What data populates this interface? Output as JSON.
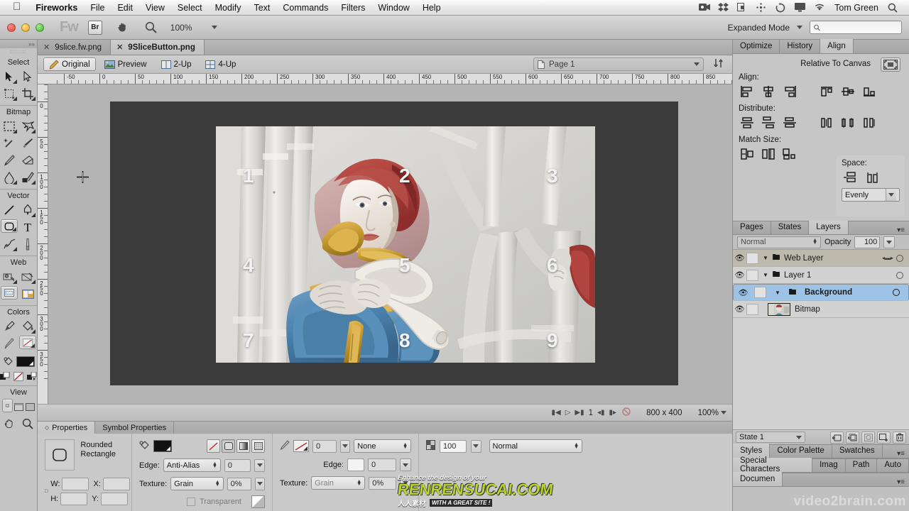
{
  "menubar": {
    "apple_icon": "apple-icon",
    "items": [
      {
        "label": "Fireworks",
        "bold": true
      },
      {
        "label": "File",
        "bold": false
      },
      {
        "label": "Edit",
        "bold": false
      },
      {
        "label": "View",
        "bold": false
      },
      {
        "label": "Select",
        "bold": false
      },
      {
        "label": "Modify",
        "bold": false
      },
      {
        "label": "Text",
        "bold": false
      },
      {
        "label": "Commands",
        "bold": false
      },
      {
        "label": "Filters",
        "bold": false
      },
      {
        "label": "Window",
        "bold": false
      },
      {
        "label": "Help",
        "bold": false
      }
    ],
    "status_icons": [
      "screen-recorder-icon",
      "dropbox-icon",
      "clipboard-icon",
      "bluetooth-icon",
      "sync-icon",
      "display-icon",
      "wifi-icon"
    ],
    "user_name": "Tom Green",
    "spotlight_icon": "search-icon"
  },
  "titlebar": {
    "app_badge": "Fw",
    "bridge_label": "Br",
    "hand_icon": "hand-icon",
    "zoom_icon": "magnifier-icon",
    "zoom_value": "100%",
    "workspace_mode": "Expanded Mode",
    "search_placeholder": ""
  },
  "toolbox": {
    "sections": [
      {
        "title": "Select",
        "tools": [
          {
            "name": "pointer-tool",
            "glyph": "arrow",
            "menu": true,
            "selected": false
          },
          {
            "name": "subselection-tool",
            "glyph": "arrow-hollow",
            "menu": false,
            "selected": false
          },
          {
            "name": "scale-tool",
            "glyph": "scale",
            "menu": true,
            "selected": false
          },
          {
            "name": "crop-tool",
            "glyph": "crop",
            "menu": true,
            "selected": false
          }
        ]
      },
      {
        "title": "Bitmap",
        "tools": [
          {
            "name": "marquee-tool",
            "glyph": "marquee",
            "menu": true,
            "selected": false
          },
          {
            "name": "lasso-tool",
            "glyph": "lasso",
            "menu": true,
            "selected": false
          },
          {
            "name": "magic-wand-tool",
            "glyph": "wand",
            "menu": false,
            "selected": false
          },
          {
            "name": "brush-tool",
            "glyph": "brush",
            "menu": false,
            "selected": false
          },
          {
            "name": "pencil-tool",
            "glyph": "pencil",
            "menu": false,
            "selected": false
          },
          {
            "name": "eraser-tool",
            "glyph": "eraser",
            "menu": false,
            "selected": false
          },
          {
            "name": "blur-tool",
            "glyph": "blur",
            "menu": true,
            "selected": false
          },
          {
            "name": "rubber-stamp-tool",
            "glyph": "stamp",
            "menu": true,
            "selected": false
          }
        ]
      },
      {
        "title": "Vector",
        "tools": [
          {
            "name": "line-tool",
            "glyph": "line",
            "menu": false,
            "selected": false
          },
          {
            "name": "pen-tool",
            "glyph": "pen",
            "menu": true,
            "selected": false
          },
          {
            "name": "rectangle-tool",
            "glyph": "rounded-rect",
            "menu": true,
            "selected": true
          },
          {
            "name": "text-tool",
            "glyph": "text-T",
            "menu": false,
            "selected": false
          },
          {
            "name": "freeform-tool",
            "glyph": "freeform",
            "menu": true,
            "selected": false
          },
          {
            "name": "knife-tool",
            "glyph": "knife",
            "menu": false,
            "selected": false
          }
        ]
      },
      {
        "title": "Web",
        "tools": [
          {
            "name": "hotspot-tool",
            "glyph": "hotspot",
            "menu": true,
            "selected": false
          },
          {
            "name": "slice-tool",
            "glyph": "slice",
            "menu": true,
            "selected": false
          },
          {
            "name": "hide-slices-tool",
            "glyph": "hide-slices",
            "menu": false,
            "selected": false
          },
          {
            "name": "show-slices-tool",
            "glyph": "show-slices",
            "menu": false,
            "selected": false
          }
        ]
      },
      {
        "title": "Colors",
        "tools": [
          {
            "name": "eyedropper-tool",
            "glyph": "eyedropper",
            "menu": false,
            "selected": false
          },
          {
            "name": "paint-bucket-tool",
            "glyph": "bucket",
            "menu": true,
            "selected": false
          },
          {
            "name": "stroke-color-swatch",
            "glyph": "stroke-pencil",
            "menu": false,
            "selected": false
          },
          {
            "name": "stroke-none-swatch",
            "glyph": "no-stroke",
            "menu": true,
            "selected": false
          }
        ]
      },
      {
        "title": "View",
        "tools": [
          {
            "name": "standard-screen-mode",
            "glyph": "screen-standard",
            "menu": false,
            "selected": true
          },
          {
            "name": "full-screen-menu-mode",
            "glyph": "screen-menu",
            "menu": false,
            "selected": false
          },
          {
            "name": "full-screen-mode",
            "glyph": "screen-full",
            "menu": false,
            "selected": false
          },
          {
            "name": "hand-tool",
            "glyph": "hand",
            "menu": false,
            "selected": false
          },
          {
            "name": "zoom-tool",
            "glyph": "magnifier",
            "menu": false,
            "selected": false
          }
        ]
      }
    ],
    "fill_color": "#111111",
    "stroke_color": "#ffffff"
  },
  "document": {
    "tabs": [
      {
        "label": "9slice.fw.png",
        "active": false
      },
      {
        "label": "9SliceButton.png",
        "active": true
      }
    ],
    "view_buttons": [
      {
        "label": "Original",
        "icon": "pencil-icon",
        "active": true
      },
      {
        "label": "Preview",
        "icon": "image-icon",
        "active": false
      },
      {
        "label": "2-Up",
        "icon": "two-up-icon",
        "active": false
      },
      {
        "label": "4-Up",
        "icon": "four-up-icon",
        "active": false
      }
    ],
    "page_selector": {
      "label": "Page 1",
      "icon": "page-icon"
    },
    "swap_icon": "swap-image-icon"
  },
  "rulers": {
    "horizontal_labels": [
      "-50",
      "0",
      "50",
      "100",
      "150",
      "200",
      "250",
      "300",
      "350",
      "400",
      "450",
      "500",
      "550",
      "600",
      "650",
      "700",
      "750",
      "800",
      "850"
    ],
    "vertical_labels": [
      "0",
      "50",
      "100",
      "150",
      "200",
      "250",
      "300",
      "350"
    ]
  },
  "canvas": {
    "image_caption": "nine-slice-grid-overlay",
    "grid_numbers": [
      "1",
      "2",
      "3",
      "4",
      "5",
      "6",
      "7",
      "8",
      "9"
    ],
    "canvas_bg": "#3b3b3b"
  },
  "statusbar": {
    "first_icon": "first-state-icon",
    "play_icon": "play-icon",
    "last_icon": "last-state-icon",
    "state_number": "1",
    "prev_icon": "prev-state-icon",
    "next_icon": "next-state-icon",
    "stop_icon": "stop-icon",
    "dimensions": "800 x 400",
    "zoom": "100%"
  },
  "properties": {
    "tabs": [
      {
        "label": "Properties",
        "active": true
      },
      {
        "label": "Symbol Properties",
        "active": false
      }
    ],
    "shape_name": "Rounded Rectangle",
    "shape_icon": "rounded-rect-icon",
    "w_label": "W:",
    "w_value": "",
    "h_label": "H:",
    "h_value": "",
    "x_label": "X:",
    "x_value": "",
    "y_label": "Y:",
    "y_value": "",
    "fill": {
      "icon": "fill-bucket-icon",
      "color": "#111111",
      "category_buttons": [
        "no-fill-icon",
        "solid-fill-icon",
        "gradient-fill-icon",
        "pattern-fill-icon"
      ],
      "edge_label": "Edge:",
      "edge_value": "Anti-Alias",
      "edge_amount": "0",
      "texture_label": "Texture:",
      "texture_value": "Grain",
      "texture_amount": "0%",
      "transparent_label": "Transparent"
    },
    "stroke": {
      "icon": "stroke-pencil-icon",
      "color_swatch": "no-stroke-icon",
      "width": "0",
      "category": "None",
      "edge_label": "Edge:",
      "edge_value": "",
      "edge_amount": "0",
      "texture_label": "Texture:",
      "texture_value": "Grain",
      "texture_amount": "0%"
    },
    "appearance": {
      "icon": "opacity-icon",
      "opacity": "100",
      "blend_mode": "Normal"
    }
  },
  "right_panels": {
    "align_group": {
      "tabs": [
        {
          "label": "Optimize",
          "active": false
        },
        {
          "label": "History",
          "active": false
        },
        {
          "label": "Align",
          "active": true
        }
      ],
      "relative_label": "Relative To Canvas",
      "relative_icon": "relative-to-canvas-icon",
      "align_label": "Align:",
      "align_buttons": [
        "align-left-icon",
        "align-center-h-icon",
        "align-right-icon",
        "align-top-icon",
        "align-middle-v-icon",
        "align-bottom-icon"
      ],
      "distribute_label": "Distribute:",
      "distribute_buttons": [
        "distribute-top-icon",
        "distribute-center-v-icon",
        "distribute-bottom-icon",
        "distribute-left-icon",
        "distribute-center-h-icon",
        "distribute-right-icon"
      ],
      "match_size_label": "Match Size:",
      "match_size_buttons": [
        "match-width-icon",
        "match-height-icon",
        "match-both-icon"
      ],
      "space_label": "Space:",
      "space_buttons": [
        "space-horizontal-icon",
        "space-vertical-icon"
      ],
      "space_value": "Evenly"
    },
    "layers_group": {
      "tabs": [
        {
          "label": "Pages",
          "active": false
        },
        {
          "label": "States",
          "active": false
        },
        {
          "label": "Layers",
          "active": true
        }
      ],
      "menu_icon": "panel-menu-icon",
      "blend_mode": "Normal",
      "opacity_label": "Opacity",
      "opacity_value": "100",
      "rows": [
        {
          "name": "Web Layer",
          "bold": false,
          "kind": "web",
          "selected": false,
          "indent": 0,
          "icon": "folder-icon"
        },
        {
          "name": "Layer 1",
          "bold": false,
          "kind": "layer",
          "selected": false,
          "indent": 0,
          "icon": "folder-icon"
        },
        {
          "name": "Background",
          "bold": true,
          "kind": "layer",
          "selected": true,
          "indent": 0,
          "icon": "folder-icon"
        },
        {
          "name": "Bitmap",
          "bold": false,
          "kind": "object",
          "selected": false,
          "indent": 1,
          "icon": "bitmap-thumb-icon"
        }
      ],
      "state_label": "State 1",
      "state_buttons": [
        "new-state-icon",
        "duplicate-state-icon",
        "onion-skin-icon",
        "new-bitmap-icon",
        "delete-icon"
      ]
    },
    "styles_group": {
      "tabs": [
        {
          "label": "Styles",
          "active": true
        },
        {
          "label": "Color Palette",
          "active": false
        },
        {
          "label": "Swatches",
          "active": false
        }
      ],
      "menu_icon": "panel-menu-icon"
    },
    "chars_group": {
      "tabs": [
        {
          "label": "Special Characters",
          "active": true
        },
        {
          "label": "Imag",
          "active": false
        },
        {
          "label": "Path",
          "active": false
        },
        {
          "label": "Auto",
          "active": false
        }
      ]
    },
    "document_group": {
      "tabs": [
        {
          "label": "Documen",
          "active": true
        }
      ]
    }
  },
  "watermarks": {
    "renrensucai_top": "Enhance the design of your",
    "renrensucai_main": "RENRENSUCAI.COM",
    "renrensucai_cn": "人人素材",
    "renrensucai_sub": "WITH A GREAT SITE !",
    "video2brain": "video2brain.com"
  }
}
